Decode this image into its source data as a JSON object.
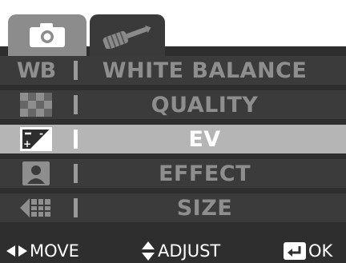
{
  "tabs": [
    {
      "id": "camera",
      "icon": "camera-icon",
      "active": true
    },
    {
      "id": "setup",
      "icon": "screwdriver-icon",
      "active": false
    }
  ],
  "menu": {
    "items": [
      {
        "icon": "white-balance-icon",
        "icon_text": "WB",
        "label": "WHITE BALANCE",
        "selected": false
      },
      {
        "icon": "quality-icon",
        "label": "QUALITY",
        "selected": false
      },
      {
        "icon": "ev-icon",
        "label": "EV",
        "selected": true
      },
      {
        "icon": "effect-icon",
        "label": "EFFECT",
        "selected": false
      },
      {
        "icon": "size-icon",
        "label": "SIZE",
        "selected": false
      }
    ]
  },
  "help": {
    "move_label": "MOVE",
    "adjust_label": "ADJUST",
    "ok_label": "OK"
  },
  "colors": {
    "background": "#2e2e2e",
    "row": "#3b3b3b",
    "row_selected": "#b5b5b5",
    "text_dim": "#8e8e8e",
    "text_bright": "#ffffff"
  }
}
